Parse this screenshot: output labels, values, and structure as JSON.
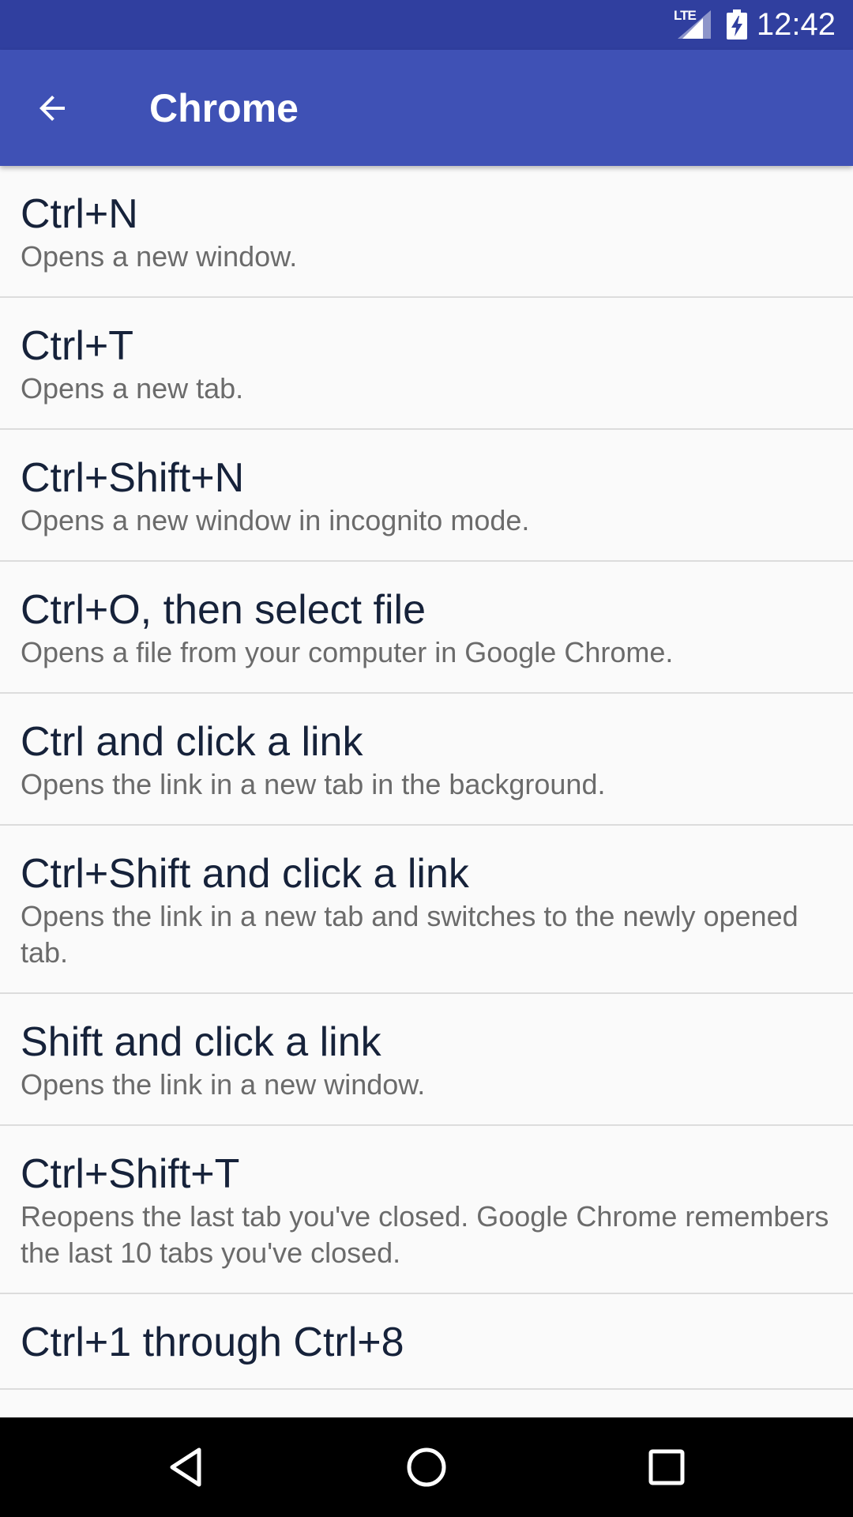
{
  "status_bar": {
    "network": "LTE",
    "time": "12:42"
  },
  "app_bar": {
    "title": "Chrome",
    "back_icon": "arrow-back-icon"
  },
  "shortcuts": [
    {
      "title": "Ctrl+N",
      "description": "Opens a new window."
    },
    {
      "title": "Ctrl+T",
      "description": "Opens a new tab."
    },
    {
      "title": "Ctrl+Shift+N",
      "description": "Opens a new window in incognito mode."
    },
    {
      "title": "Ctrl+O, then select file",
      "description": "Opens a file from your computer in Google Chrome."
    },
    {
      "title": "Ctrl and click a link",
      "description": "Opens the link in a new tab in the background."
    },
    {
      "title": "Ctrl+Shift and click a link",
      "description": "Opens the link in a new tab and switches to the newly opened tab."
    },
    {
      "title": "Shift and click a link",
      "description": "Opens the link in a new window."
    },
    {
      "title": "Ctrl+Shift+T",
      "description": "Reopens the last tab you've closed. Google Chrome remembers the last 10 tabs you've closed."
    },
    {
      "title": "Ctrl+1 through Ctrl+8",
      "description": ""
    }
  ],
  "nav_bar": {
    "back_icon": "triangle-back-icon",
    "home_icon": "circle-home-icon",
    "recents_icon": "square-recents-icon"
  },
  "colors": {
    "status_bar": "#303f9f",
    "app_bar": "#3f51b5",
    "background": "#fafafa",
    "title_text": "#16223a",
    "desc_text": "#6b6b6b"
  }
}
